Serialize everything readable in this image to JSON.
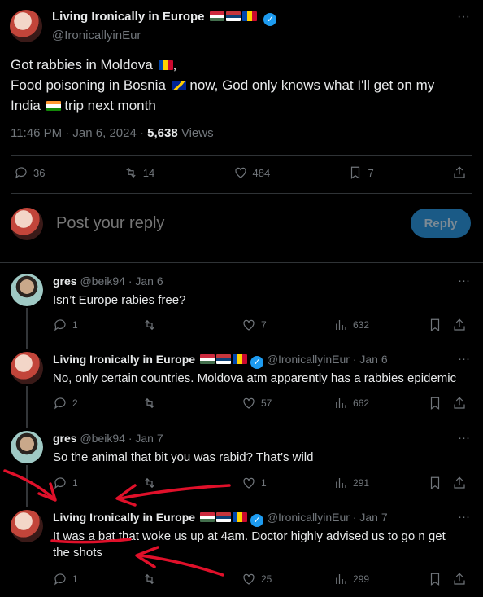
{
  "main": {
    "name": "Living Ironically in Europe",
    "handle": "@IronicallyinEur",
    "text_line1": "Got rabbies in Moldova",
    "text_line1_end": ",",
    "text_line2a": "Food poisoning in Bosnia",
    "text_line2b": " now, God only knows what I'll get on my",
    "text_line3a": "India",
    "text_line3b": " trip next month",
    "time": "11:46 PM · Jan 6, 2024 · ",
    "views_count": "5,638",
    "views_label": " Views",
    "replies": "36",
    "reposts": "14",
    "likes": "484",
    "bookmarks": "7"
  },
  "reply_box": {
    "placeholder": "Post your reply",
    "button": "Reply"
  },
  "replies": [
    {
      "name": "gres",
      "handle": "@beik94 · Jan 6",
      "text": "Isn’t Europe rabies free?",
      "replies": "1",
      "reposts": "",
      "likes": "7",
      "views": "632"
    },
    {
      "name": "Living Ironically in Europe",
      "handle": "@IronicallyinEur · Jan 6",
      "text": "No, only certain countries. Moldova atm apparently has a rabbies epidemic",
      "replies": "2",
      "reposts": "",
      "likes": "57",
      "views": "662"
    },
    {
      "name": "gres",
      "handle": "@beik94 · Jan 7",
      "text": "So the animal that bit you was rabid? That’s wild",
      "replies": "1",
      "reposts": "",
      "likes": "1",
      "views": "291"
    },
    {
      "name": "Living Ironically in Europe",
      "handle": "@IronicallyinEur · Jan 7",
      "text": "It was a bat that woke us up at 4am. Doctor highly advised us to go n get the shots",
      "replies": "1",
      "reposts": "",
      "likes": "25",
      "views": "299"
    }
  ],
  "colors": {
    "accent": "#1d9bf0",
    "annotation": "#e0102a"
  }
}
